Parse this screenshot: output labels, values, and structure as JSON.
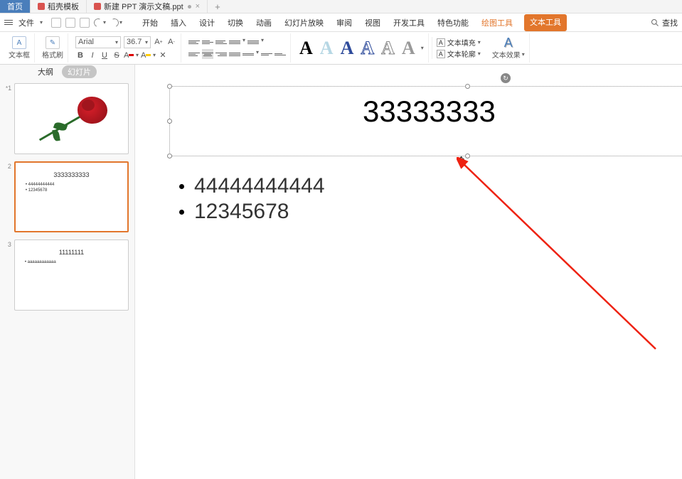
{
  "title_bar": {
    "home": "首页",
    "template_tab": "稻壳模板",
    "doc_tab": "新建 PPT 演示文稿.ppt",
    "add": "+"
  },
  "menu": {
    "file": "文件",
    "tabs": {
      "start": "开始",
      "insert": "插入",
      "design": "设计",
      "transition": "切换",
      "animation": "动画",
      "slideshow": "幻灯片放映",
      "review": "审阅",
      "view": "视图",
      "developer": "开发工具",
      "special": "特色功能",
      "draw": "绘图工具",
      "text": "文本工具"
    },
    "search": "查找"
  },
  "ribbon": {
    "textbox": "文本框",
    "format_painter": "格式刷",
    "font_name": "Arial",
    "font_size": "36.7",
    "text_fill": "文本填充",
    "text_outline": "文本轮廓",
    "text_effect": "文本效果"
  },
  "side": {
    "outline": "大纲",
    "slides": "幻灯片",
    "thumb1_num": "1",
    "star1": "*",
    "thumb2_num": "2",
    "thumb2_title": "3333333333",
    "thumb2_b1": "• 44444444444",
    "thumb2_b2": "• 12345678",
    "thumb3_num": "3",
    "thumb3_title": "11111111",
    "thumb3_b1": "• aaaaaaaaaaaa"
  },
  "slide": {
    "title": "33333333",
    "bullet1": "44444444444",
    "bullet2": "12345678"
  }
}
